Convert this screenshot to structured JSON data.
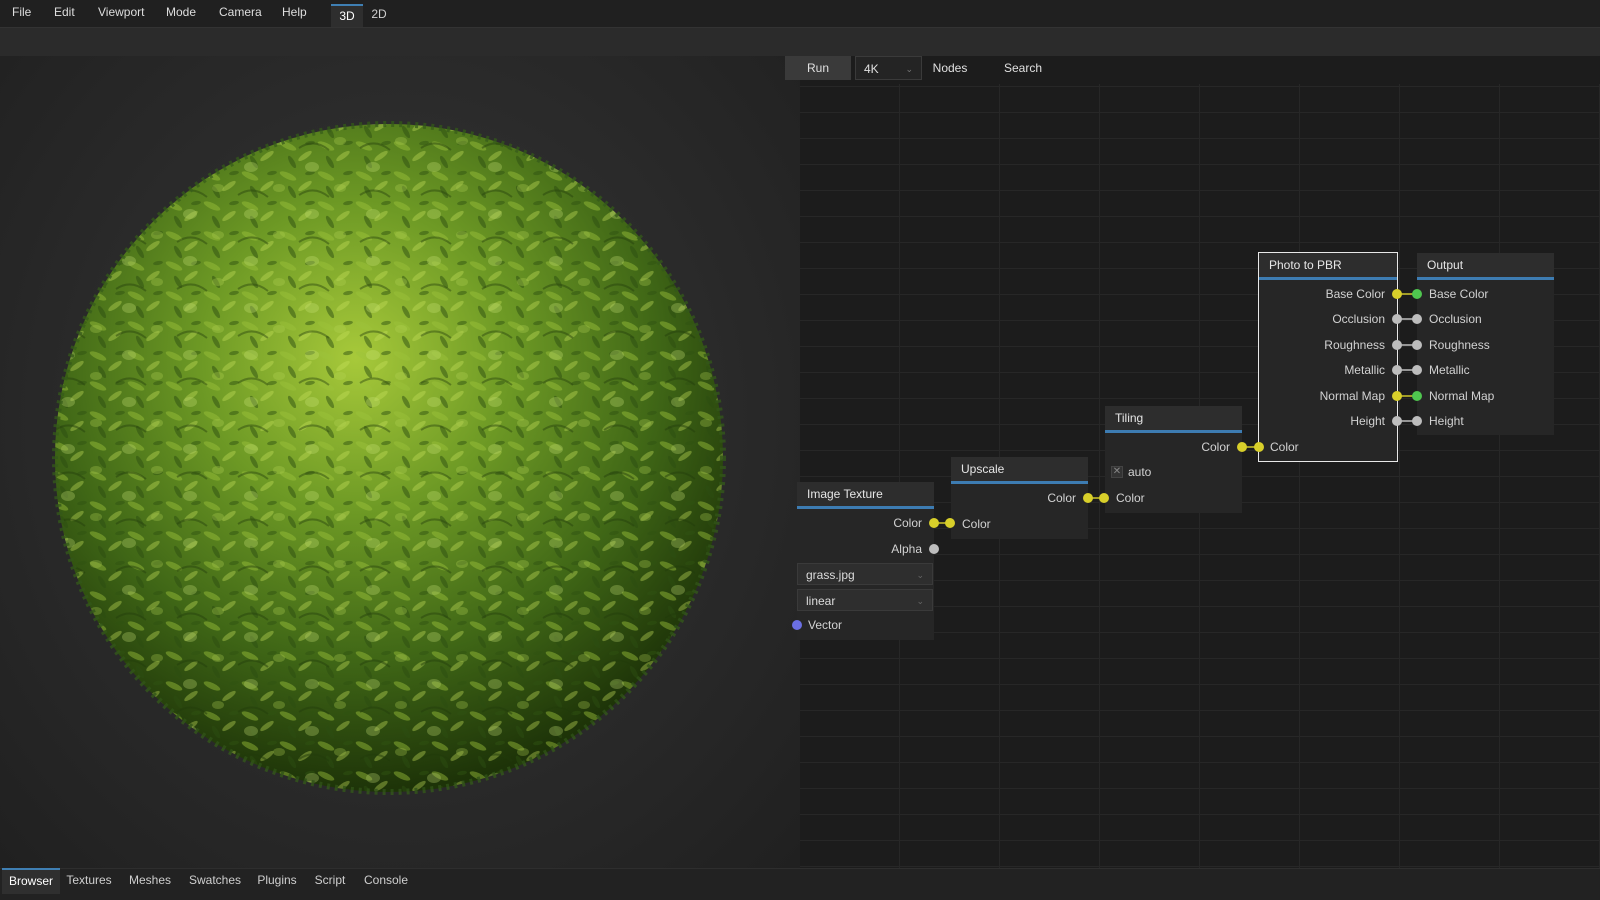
{
  "menu": [
    "File",
    "Edit",
    "Viewport",
    "Mode",
    "Camera",
    "Help"
  ],
  "mode_tabs": {
    "tab_3d": "3D",
    "tab_2d": "2D",
    "active": "3D"
  },
  "graph_toolbar": {
    "run": "Run",
    "resolution": "4K",
    "nodes": "Nodes",
    "search": "Search"
  },
  "nodes": {
    "image_texture": {
      "title": "Image Texture",
      "outputs": [
        "Color",
        "Alpha"
      ],
      "file": "grass.jpg",
      "interpolation": "linear",
      "input": "Vector"
    },
    "upscale": {
      "title": "Upscale",
      "output": "Color",
      "input": "Color"
    },
    "tiling": {
      "title": "Tiling",
      "output": "Color",
      "checkbox_label": "auto",
      "input": "Color"
    },
    "photo_to_pbr": {
      "title": "Photo to PBR",
      "input": "Color",
      "outputs": [
        "Base Color",
        "Occlusion",
        "Roughness",
        "Metallic",
        "Normal Map",
        "Height"
      ]
    },
    "output": {
      "title": "Output",
      "inputs": [
        "Base Color",
        "Occlusion",
        "Roughness",
        "Metallic",
        "Normal Map",
        "Height"
      ]
    }
  },
  "socket_colors": {
    "color": "#d8cf2a",
    "active": "#4fc64f",
    "float": "#bdbdbd",
    "vector": "#6b6fe3"
  },
  "bottom_tabs": [
    "Browser",
    "Textures",
    "Meshes",
    "Swatches",
    "Plugins",
    "Script",
    "Console"
  ],
  "accent": "#3d7cb2"
}
